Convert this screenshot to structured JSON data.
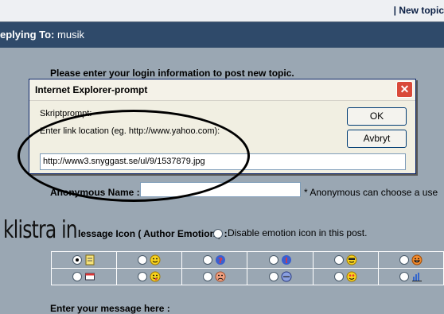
{
  "topbar": {
    "new_topic": "| New topic"
  },
  "reply": {
    "prefix": "eplying To",
    "colon": ":",
    "topic": "musik"
  },
  "form": {
    "login_message": "Please enter your login information to post new topic.",
    "anon_label": "Anonymous Name :",
    "anon_value": "",
    "anon_note": "* Anonymous can choose a use",
    "message_icon_label": "lessage Icon ( Author Emotion ) :",
    "disable_emotion": "Disable emotion icon in this post.",
    "enter_message": "Enter your message here :"
  },
  "overlay_text": "klistra in",
  "dialog": {
    "title": "Internet Explorer-prompt",
    "close": "✕",
    "script_prompt": "Skriptprompt:",
    "description": "Enter link location (eg. http://www.yahoo.com):",
    "ok": "OK",
    "cancel": "Avbryt",
    "input_value": "http://www3.snyggast.se/ul/9/1537879.jpg"
  },
  "emoticons": [
    [
      "page-icon",
      "smile-icon",
      "question-icon",
      "exclaim-icon",
      "cool-icon",
      "grin-icon"
    ],
    [
      "window-icon",
      "tongue-icon",
      "sad-icon",
      "neutral-icon",
      "love-icon",
      "chart-icon"
    ]
  ],
  "selected_emoticon": "page-icon",
  "colors": {
    "header": "#2f4a6a",
    "background": "#9aa7b3",
    "close": "#d94a3a"
  }
}
